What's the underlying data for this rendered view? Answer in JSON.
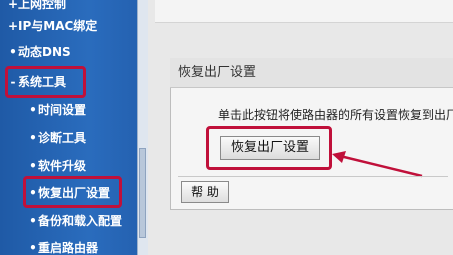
{
  "sidebar": {
    "items": [
      {
        "mark": "+",
        "label": "上网控制",
        "level": 1
      },
      {
        "mark": "+",
        "label": "IP与MAC绑定",
        "level": 1
      },
      {
        "mark": "•",
        "label": "动态DNS",
        "level": 1
      },
      {
        "mark": "-",
        "label": "系统工具",
        "level": 1
      },
      {
        "mark": "•",
        "label": "时间设置",
        "level": 2
      },
      {
        "mark": "•",
        "label": "诊断工具",
        "level": 2
      },
      {
        "mark": "•",
        "label": "软件升级",
        "level": 2
      },
      {
        "mark": "•",
        "label": "恢复出厂设置",
        "level": 2
      },
      {
        "mark": "•",
        "label": "备份和载入配置",
        "level": 2
      },
      {
        "mark": "•",
        "label": "重启路由器",
        "level": 2
      }
    ]
  },
  "panel": {
    "title": "恢复出厂设置",
    "description": "单击此按钮将使路由器的所有设置恢复到出厂",
    "reset_button": "恢复出厂设置",
    "help_button": "帮 助"
  },
  "colors": {
    "sidebar_blue": "#2a6cbd",
    "highlight_red": "#c0103a"
  }
}
